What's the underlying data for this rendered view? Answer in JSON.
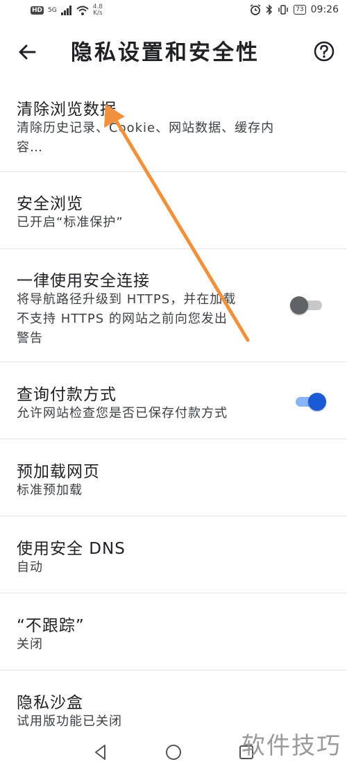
{
  "status_bar": {
    "net_badge": "HD",
    "net_type": "5G",
    "speed_value": "4.8",
    "speed_unit": "K/s",
    "battery": "73",
    "time": "09:26"
  },
  "app_bar": {
    "title": "隐私设置和安全性"
  },
  "settings": [
    {
      "title": "清除浏览数据",
      "subtitle_lines": [
        "清除历史记录、Cookie、网站数据、缓存内",
        "容…"
      ]
    },
    {
      "title": "安全浏览",
      "subtitle_lines": [
        "已开启“标准保护”"
      ]
    },
    {
      "title": "一律使用安全连接",
      "subtitle_lines": [
        "将导航路径升级到 HTTPS，并在加载",
        "不支持 HTTPS 的网站之前向您发出",
        "警告"
      ],
      "toggle": false
    },
    {
      "title": "查询付款方式",
      "subtitle_lines": [
        "允许网站检查您是否已保存付款方式"
      ],
      "toggle": true
    },
    {
      "title": "预加载网页",
      "subtitle_lines": [
        "标准预加载"
      ]
    },
    {
      "title": "使用安全 DNS",
      "subtitle_lines": [
        "自动"
      ]
    },
    {
      "title": "“不跟踪”",
      "subtitle_lines": [
        "关闭"
      ]
    },
    {
      "title": "隐私沙盒",
      "subtitle_lines": [
        "试用版功能已关闭"
      ]
    }
  ],
  "watermark": "软件技巧",
  "colors": {
    "toggle_on_thumb": "#1a5ad6",
    "toggle_on_track": "#8ab4f8",
    "toggle_off_thumb": "#5f6368",
    "annotation_arrow": "#f2913b"
  }
}
